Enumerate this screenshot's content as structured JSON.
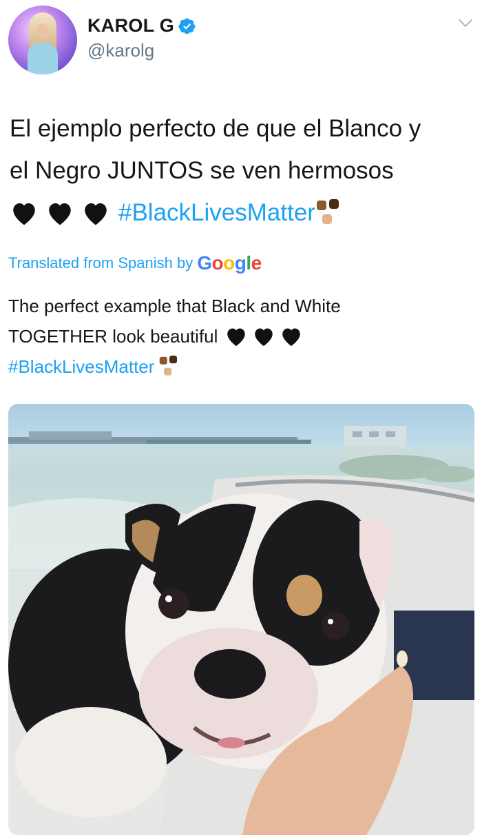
{
  "author": {
    "display_name": "KAROL G",
    "handle": "@karolg",
    "verified": true,
    "avatar_icon": "profile-photo"
  },
  "tweet": {
    "text_line1": "El ejemplo perfecto de que el Blanco y",
    "text_line2": "el Negro JUNTOS se ven hermosos",
    "hashtag": "#BlackLivesMatter",
    "emoji": [
      "black-heart",
      "black-heart",
      "black-heart",
      "raised-fists"
    ]
  },
  "translation": {
    "label": "Translated from Spanish by",
    "provider": "Google",
    "line1": "The perfect example that Black and White",
    "line2": "TOGETHER look beautiful",
    "hashtag": "#BlackLivesMatter"
  },
  "colors": {
    "link": "#1da1f2",
    "text": "#14171a",
    "secondary": "#657786"
  },
  "media": {
    "type": "photo",
    "subject": "puppy-on-boat"
  }
}
